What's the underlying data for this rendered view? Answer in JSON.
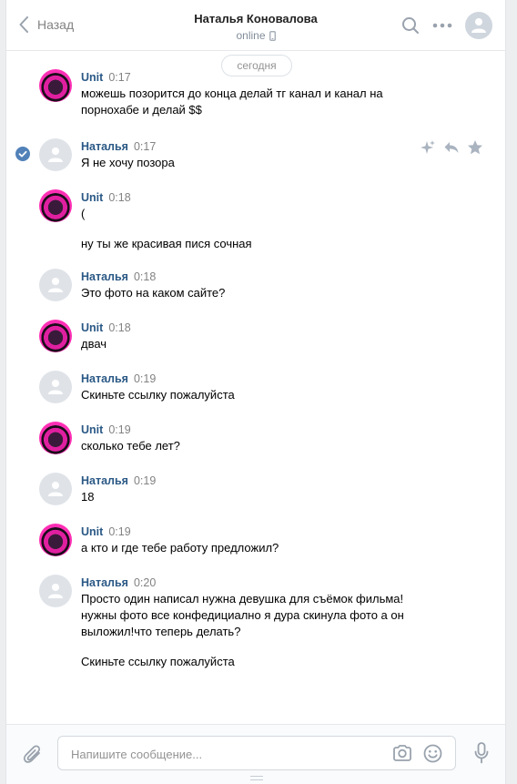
{
  "header": {
    "back_label": "Назад",
    "contact_name": "Наталья Коновалова",
    "status": "online"
  },
  "feed": {
    "date_label": "сегодня"
  },
  "messages": [
    {
      "author": "Unit",
      "time": "0:17",
      "avatar": "unit",
      "texts": [
        "можешь позорится до конца делай тг канал и канал на порнохабе и делай $$"
      ]
    },
    {
      "author": "Наталья",
      "time": "0:17",
      "avatar": "grey",
      "texts": [
        "Я не хочу позора"
      ],
      "selected": true
    },
    {
      "author": "Unit",
      "time": "0:18",
      "avatar": "unit",
      "texts": [
        "(",
        "ну ты же красивая пися сочная"
      ]
    },
    {
      "author": "Наталья",
      "time": "0:18",
      "avatar": "grey",
      "texts": [
        "Это фото на каком сайте?"
      ]
    },
    {
      "author": "Unit",
      "time": "0:18",
      "avatar": "unit",
      "texts": [
        "двач"
      ]
    },
    {
      "author": "Наталья",
      "time": "0:19",
      "avatar": "grey",
      "texts": [
        "Скиньте ссылку пожалуйста"
      ]
    },
    {
      "author": "Unit",
      "time": "0:19",
      "avatar": "unit",
      "texts": [
        "сколько тебе лет?"
      ]
    },
    {
      "author": "Наталья",
      "time": "0:19",
      "avatar": "grey",
      "texts": [
        "18"
      ]
    },
    {
      "author": "Unit",
      "time": "0:19",
      "avatar": "unit",
      "texts": [
        "а кто и где тебе работу предложил?"
      ]
    },
    {
      "author": "Наталья",
      "time": "0:20",
      "avatar": "grey",
      "texts": [
        "Просто один написал нужна девушка для съёмок фильма! нужны фото все конфедициално я дура скинула фото а он выложил!что теперь делать?",
        "Скиньте ссылку пожалуйста"
      ]
    }
  ],
  "composer": {
    "placeholder": "Напишите сообщение..."
  },
  "icons": {
    "back": "chevron-left-icon",
    "search": "search-icon",
    "more": "more-dots-icon",
    "attach": "paperclip-icon",
    "camera": "camera-icon",
    "emoji": "smile-icon",
    "mic": "microphone-icon",
    "check": "check-circle-icon"
  },
  "colors": {
    "link": "#2a5885",
    "accent": "#5181b8",
    "muted": "#828282"
  }
}
